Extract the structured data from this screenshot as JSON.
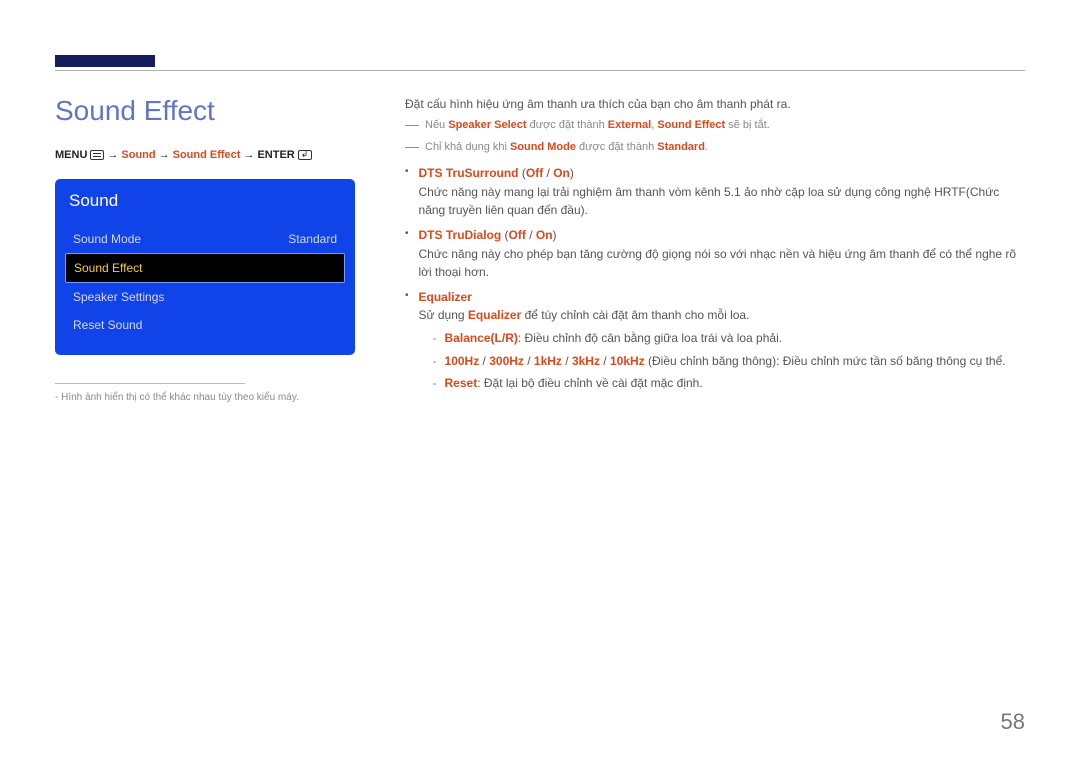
{
  "page_number": "58",
  "title": "Sound Effect",
  "breadcrumb": {
    "menu": "MENU",
    "seg1": "Sound",
    "seg2": "Sound Effect",
    "enter": "ENTER",
    "arrow": "→"
  },
  "osd": {
    "title": "Sound",
    "items": [
      {
        "label": "Sound Mode",
        "value": "Standard",
        "selected": false
      },
      {
        "label": "Sound Effect",
        "value": "",
        "selected": true
      },
      {
        "label": "Speaker Settings",
        "value": "",
        "selected": false
      },
      {
        "label": "Reset Sound",
        "value": "",
        "selected": false
      }
    ]
  },
  "footnote": "Hình ảnh hiển thị có thể khác nhau tùy theo kiểu máy.",
  "intro": "Đặt cấu hình hiệu ứng âm thanh ưa thích của bạn cho âm thanh phát ra.",
  "cond1": {
    "pre": "Nếu ",
    "a": "Speaker Select",
    "mid": " được đặt thành ",
    "b": "External",
    "sep": ", ",
    "c": "Sound Effect",
    "post": " sẽ bị tắt."
  },
  "cond2": {
    "pre": "Chỉ khả dụng khi ",
    "a": "Sound Mode",
    "mid": " được đặt thành ",
    "b": "Standard",
    "post": "."
  },
  "bullets": {
    "b1": {
      "name": "DTS TruSurround",
      "paren_open": " (",
      "off": "Off",
      "slash": " / ",
      "on": "On",
      "paren_close": ")",
      "desc": "Chức năng này mang lại trải nghiệm âm thanh vòm kênh 5.1 ảo nhờ cặp loa sử dụng công nghệ HRTF(Chức năng truyền liên quan đến đầu)."
    },
    "b2": {
      "name": "DTS TruDialog",
      "paren_open": " (",
      "off": "Off",
      "slash": " / ",
      "on": "On",
      "paren_close": ")",
      "desc": "Chức năng này cho phép bạn tăng cường độ giọng nói so với nhạc nền và hiệu ứng âm thanh để có thể nghe rõ lời thoại hơn."
    },
    "b3": {
      "name": "Equalizer",
      "desc_pre": "Sử dụng ",
      "desc_mid": "Equalizer",
      "desc_post": " để tùy chỉnh cài đặt âm thanh cho mỗi loa.",
      "sub": [
        {
          "name": "Balance(L/R)",
          "text": ": Điều chỉnh độ cân bằng giữa loa trái và loa phải."
        },
        {
          "freq": [
            "100Hz",
            "300Hz",
            "1kHz",
            "3kHz",
            "10kHz"
          ],
          "slash": " / ",
          "text": " (Điều chỉnh băng thông): Điều chỉnh mức tần số băng thông cụ thể."
        },
        {
          "name": "Reset",
          "text": ": Đặt lại bộ điều chỉnh về cài đặt mặc định."
        }
      ]
    }
  }
}
